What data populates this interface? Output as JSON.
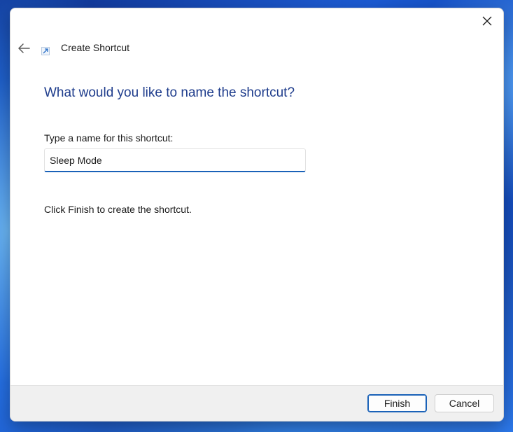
{
  "window": {
    "title": "Create Shortcut"
  },
  "icons": {
    "close": "close-icon",
    "back": "back-arrow-icon",
    "title": "shortcut-icon"
  },
  "content": {
    "heading": "What would you like to name the shortcut?",
    "field_label": "Type a name for this shortcut:",
    "name_value": "Sleep Mode",
    "hint": "Click Finish to create the shortcut."
  },
  "footer": {
    "finish_label": "Finish",
    "cancel_label": "Cancel"
  },
  "colors": {
    "accent": "#1a62b8",
    "heading": "#1e3c8c"
  }
}
